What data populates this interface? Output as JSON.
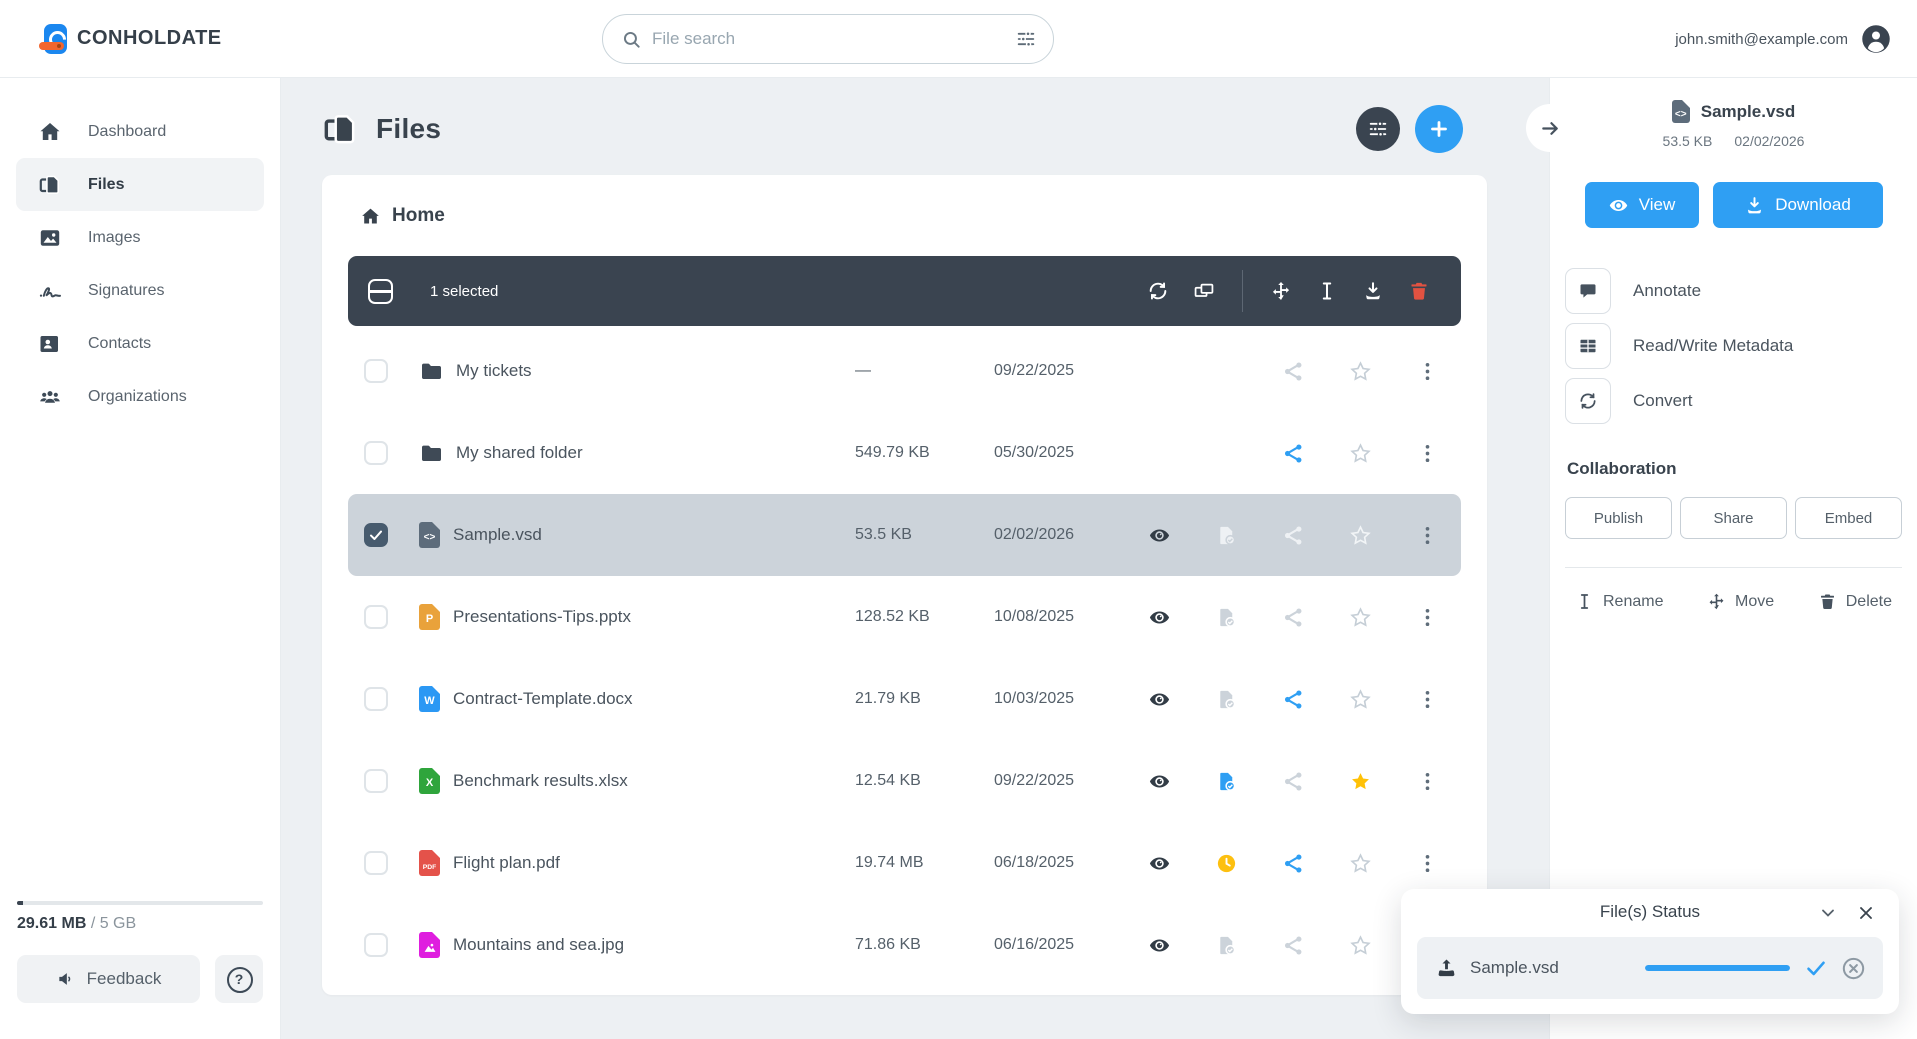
{
  "topbar": {
    "brand": "CONHOLDATE",
    "search_placeholder": "File search",
    "user_email": "john.smith@example.com"
  },
  "sidebar": {
    "items": [
      {
        "label": "Dashboard",
        "icon": "home-icon"
      },
      {
        "label": "Files",
        "icon": "files-icon",
        "active": true
      },
      {
        "label": "Images",
        "icon": "image-icon"
      },
      {
        "label": "Signatures",
        "icon": "signature-icon"
      },
      {
        "label": "Contacts",
        "icon": "contacts-icon"
      },
      {
        "label": "Organizations",
        "icon": "organizations-icon"
      }
    ],
    "storage_used": "29.61 MB",
    "storage_total_suffix": " / 5 GB",
    "feedback_label": "Feedback"
  },
  "main": {
    "title": "Files",
    "breadcrumb_home": "Home",
    "selection_toolbar": {
      "selected_count_label": "1 selected"
    },
    "files": [
      {
        "name": "My tickets",
        "type": "folder",
        "size": "—",
        "date": "09/22/2025",
        "shared": false,
        "starred": false
      },
      {
        "name": "My shared folder",
        "type": "folder",
        "size": "549.79 KB",
        "date": "05/30/2025",
        "shared": true,
        "starred": false
      },
      {
        "name": "Sample.vsd",
        "type": "vsd",
        "badge": "<>",
        "size": "53.5 KB",
        "date": "02/02/2026",
        "selected": true,
        "shared": false,
        "starred": false
      },
      {
        "name": "Presentations-Tips.pptx",
        "type": "pptx",
        "badge": "P",
        "size": "128.52 KB",
        "date": "10/08/2025",
        "shared": false,
        "starred": false
      },
      {
        "name": "Contract-Template.docx",
        "type": "docx",
        "badge": "W",
        "size": "21.79 KB",
        "date": "10/03/2025",
        "shared": true,
        "starred": false
      },
      {
        "name": "Benchmark results.xlsx",
        "type": "xlsx",
        "badge": "X",
        "size": "12.54 KB",
        "date": "09/22/2025",
        "shared": false,
        "starred": true
      },
      {
        "name": "Flight plan.pdf",
        "type": "pdf",
        "badge": "PDF",
        "size": "19.74 MB",
        "date": "06/18/2025",
        "shared": true,
        "starred": false,
        "pending": true
      },
      {
        "name": "Mountains and sea.jpg",
        "type": "jpg",
        "size": "71.86 KB",
        "date": "06/16/2025",
        "shared": false,
        "starred": false
      }
    ]
  },
  "details_panel": {
    "file_name": "Sample.vsd",
    "file_size": "53.5 KB",
    "file_date": "02/02/2026",
    "view_label": "View",
    "download_label": "Download",
    "annotate_label": "Annotate",
    "metadata_label": "Read/Write Metadata",
    "convert_label": "Convert",
    "collaboration_title": "Collaboration",
    "publish_label": "Publish",
    "share_label": "Share",
    "embed_label": "Embed",
    "rename_label": "Rename",
    "move_label": "Move",
    "delete_label": "Delete"
  },
  "status_popup": {
    "title": "File(s) Status",
    "file_name": "Sample.vsd",
    "progress_percent": 100
  },
  "colors": {
    "accent_blue": "#2f9ff3",
    "dark_slate": "#3a4450",
    "selected_row": "#ccd3da",
    "star_active": "#ffc107",
    "danger_red": "#e15241"
  }
}
